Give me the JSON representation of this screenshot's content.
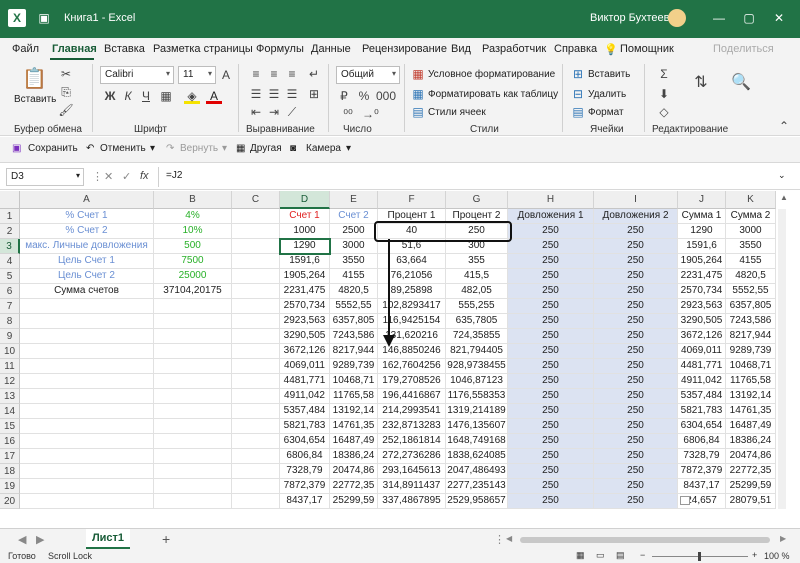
{
  "window": {
    "file_name": "Книга1  -  Excel",
    "user_name": "Виктор Бухтеев",
    "brand_color": "#217346"
  },
  "menu": {
    "items": [
      "Файл",
      "Главная",
      "Вставка",
      "Разметка страницы",
      "Формулы",
      "Данные",
      "Рецензирование",
      "Вид",
      "Разработчик",
      "Справка",
      "Помощник",
      "Поделиться"
    ],
    "active": "Главная"
  },
  "ribbon": {
    "paste_label": "Вставить",
    "font_name": "Calibri",
    "font_size": "11",
    "number_format": "Общий",
    "bold": "Ж",
    "italic": "К",
    "underline": "Ч",
    "styles": [
      "Условное форматирование",
      "Форматировать как таблицу",
      "Стили ячеек"
    ],
    "cells": [
      "Вставить",
      "Удалить",
      "Формат"
    ],
    "groups": [
      "Буфер обмена",
      "Шрифт",
      "Выравнивание",
      "Число",
      "Стили",
      "Ячейки",
      "Редактирование"
    ]
  },
  "quick_access": {
    "items": [
      "Сохранить",
      "Отменить",
      "Вернуть",
      "Другая",
      "Камера"
    ]
  },
  "formula_bar": {
    "cell_ref": "D3",
    "fx": "fx",
    "formula": "=J2"
  },
  "sheet": {
    "columns": [
      "A",
      "B",
      "C",
      "D",
      "E",
      "F",
      "G",
      "H",
      "I",
      "J",
      "K"
    ],
    "rows": [
      "1",
      "2",
      "3",
      "4",
      "5",
      "6",
      "7",
      "8",
      "9",
      "10",
      "11",
      "12",
      "13",
      "14",
      "15",
      "16",
      "17",
      "18",
      "19",
      "20"
    ],
    "a_col": [
      "% Счет 1",
      "% Счет 2",
      "макс. Личные довложения",
      "Цель Счет 1",
      "Цель Счет 2",
      "Сумма счетов"
    ],
    "b_col": [
      "4%",
      "10%",
      "500",
      "7500",
      "25000",
      "37104,20175"
    ],
    "headers": [
      "Счет 1",
      "Счет 2",
      "Процент 1",
      "Процент 2",
      "Довложения 1",
      "Довложения 2",
      "Сумма 1",
      "Сумма 2"
    ],
    "d": [
      "1000",
      "1290",
      "1591,6",
      "1905,264",
      "2231,475",
      "2570,734",
      "2923,563",
      "3290,505",
      "3672,126",
      "4069,011",
      "4481,771",
      "4911,042",
      "5357,484",
      "5821,783",
      "6304,654",
      "6806,84",
      "7328,79",
      "7872,379",
      "8437,17"
    ],
    "e": [
      "2500",
      "3000",
      "3550",
      "4155",
      "4820,5",
      "5552,55",
      "6357,805",
      "7243,586",
      "8217,944",
      "9289,739",
      "10468,71",
      "11765,58",
      "13192,14",
      "14761,35",
      "16487,49",
      "18386,24",
      "20474,86",
      "22772,35",
      "25299,59"
    ],
    "f": [
      "40",
      "51,6",
      "63,664",
      "76,21056",
      "89,25898",
      "102,8293417",
      "116,9425154",
      "131,620216",
      "146,8850246",
      "162,7604256",
      "179,2708526",
      "196,4416867",
      "214,2993541",
      "232,8713283",
      "252,1861814",
      "272,2736286",
      "293,1645613",
      "314,8911437",
      "337,4867895"
    ],
    "g": [
      "250",
      "300",
      "355",
      "415,5",
      "482,05",
      "555,255",
      "635,7805",
      "724,35855",
      "821,794405",
      "928,9738455",
      "1046,87123",
      "1176,558353",
      "1319,214189",
      "1476,135607",
      "1648,749168",
      "1838,624085",
      "2047,486493",
      "2277,235143",
      "2529,958657"
    ],
    "h_value": "250",
    "i_value": "250",
    "j": [
      "1290",
      "1591,6",
      "1905,264",
      "2231,475",
      "2570,734",
      "2923,563",
      "3290,505",
      "3672,126",
      "4069,011",
      "4481,771",
      "4911,042",
      "5357,484",
      "5821,783",
      "6304,654",
      "6806,84",
      "7328,79",
      "7872,379",
      "8437,17",
      "24,657"
    ],
    "k": [
      "3000",
      "3550",
      "4155",
      "4820,5",
      "5552,55",
      "6357,805",
      "7243,586",
      "8217,944",
      "9289,739",
      "10468,71",
      "11765,58",
      "13192,14",
      "14761,35",
      "16487,49",
      "18386,24",
      "20474,86",
      "22772,35",
      "25299,59",
      "28079,51"
    ]
  },
  "tabs": {
    "sheet_name": "Лист1",
    "add": "+"
  },
  "status": {
    "ready": "Готово",
    "scroll_lock": "Scroll Lock",
    "zoom": "100 %"
  }
}
